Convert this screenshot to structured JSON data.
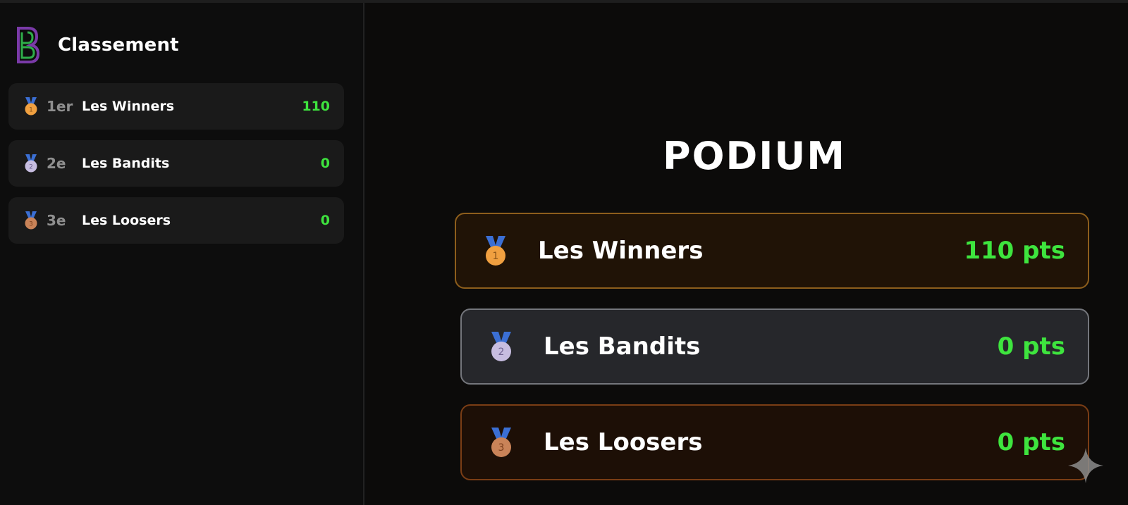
{
  "sidebar": {
    "title": "Classement",
    "logo_icon": "brand-b-logo",
    "items": [
      {
        "position": "1er",
        "team": "Les Winners",
        "score": "110",
        "medal": "gold-medal-icon",
        "medal_number": "1"
      },
      {
        "position": "2e",
        "team": "Les Bandits",
        "score": "0",
        "medal": "silver-medal-icon",
        "medal_number": "2"
      },
      {
        "position": "3e",
        "team": "Les Loosers",
        "score": "0",
        "medal": "bronze-medal-icon",
        "medal_number": "3"
      }
    ]
  },
  "podium": {
    "title": "PODIUM",
    "entries": [
      {
        "team": "Les Winners",
        "score": "110 pts",
        "medal": "gold-medal-icon",
        "medal_number": "1"
      },
      {
        "team": "Les Bandits",
        "score": "0 pts",
        "medal": "silver-medal-icon",
        "medal_number": "2"
      },
      {
        "team": "Les Loosers",
        "score": "0 pts",
        "medal": "bronze-medal-icon",
        "medal_number": "3"
      }
    ]
  },
  "colors": {
    "score_green": "#3ee43e",
    "gold": "#f0a040",
    "silver": "#c7bde0",
    "bronze": "#c98358",
    "ribbon": "#3b6fd4"
  },
  "corner_icon": "sparkle-icon"
}
